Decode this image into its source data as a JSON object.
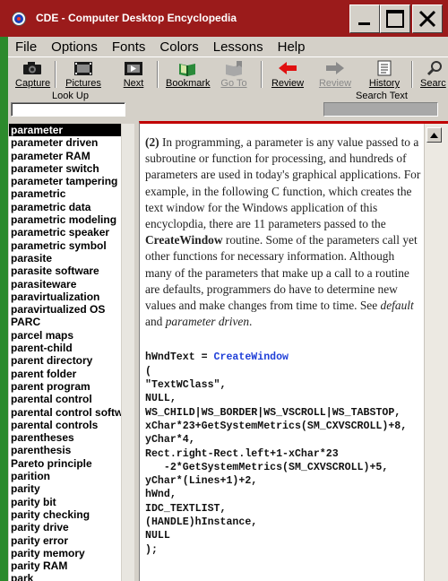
{
  "window": {
    "title": "CDE - Computer Desktop Encyclopedia"
  },
  "menu": [
    "File",
    "Options",
    "Fonts",
    "Colors",
    "Lessons",
    "Help"
  ],
  "toolbar": {
    "capture": "Capture",
    "pictures": "Pictures",
    "next": "Next",
    "bookmark": "Bookmark",
    "goto": "Go To",
    "review_back": "Review",
    "review_fwd": "Review",
    "history": "History",
    "search": "Searc"
  },
  "lookup": {
    "label": "Look Up",
    "value": ""
  },
  "search_text": {
    "label": "Search Text",
    "value": ""
  },
  "terms": [
    "parameter",
    "parameter driven",
    "parameter RAM",
    "parameter switch",
    "parameter tampering",
    "parametric",
    "parametric data",
    "parametric modeling",
    "parametric speaker",
    "parametric symbol",
    "parasite",
    "parasite software",
    "parasiteware",
    "paravirtualization",
    "paravirtualized OS",
    "PARC",
    "parcel maps",
    "parent-child",
    "parent directory",
    "parent folder",
    "parent program",
    "parental control",
    "parental control softw",
    "parental controls",
    "parentheses",
    "parenthesis",
    "Pareto principle",
    "parition",
    "parity",
    "parity bit",
    "parity checking",
    "parity drive",
    "parity error",
    "parity memory",
    "parity RAM",
    "park"
  ],
  "article": {
    "num": "(2)",
    "p1": " In programming, a parameter is any value passed to a subroutine or function for processing, and hundreds of parameters are used in today's graphical applications.  For example, in the following C function, which creates the text window for the Windows application of this encyclopdia, there are 11 parameters passed to the ",
    "term": "CreateWindow",
    "p2": " routine.  Some of the parameters call yet other functions for necessary information.  Although many of the parameters that make up a call to a routine are defaults, programmers do have to determine new values and make changes from time to time.  See ",
    "see1": "default",
    "and": " and ",
    "see2": "parameter driven",
    "end": ".",
    "code_prefix": "hWndText = ",
    "code_kw": "CreateWindow",
    "code_rest": "(\n\"TextWClass\",\nNULL,\nWS_CHILD|WS_BORDER|WS_VSCROLL|WS_TABSTOP,\nxChar*23+GetSystemMetrics(SM_CXVSCROLL)+8,\nyChar*4,\nRect.right-Rect.left+1-xChar*23\n   -2*GetSystemMetrics(SM_CXVSCROLL)+5,\nyChar*(Lines+1)+2,\nhWnd,\nIDC_TEXTLIST,\n(HANDLE)hInstance,\nNULL\n);"
  },
  "colors": {
    "titlebar": "#9b1b1b",
    "selected": "#000000",
    "content_border": "#c00000",
    "code_keyword": "#1f3fd8"
  }
}
